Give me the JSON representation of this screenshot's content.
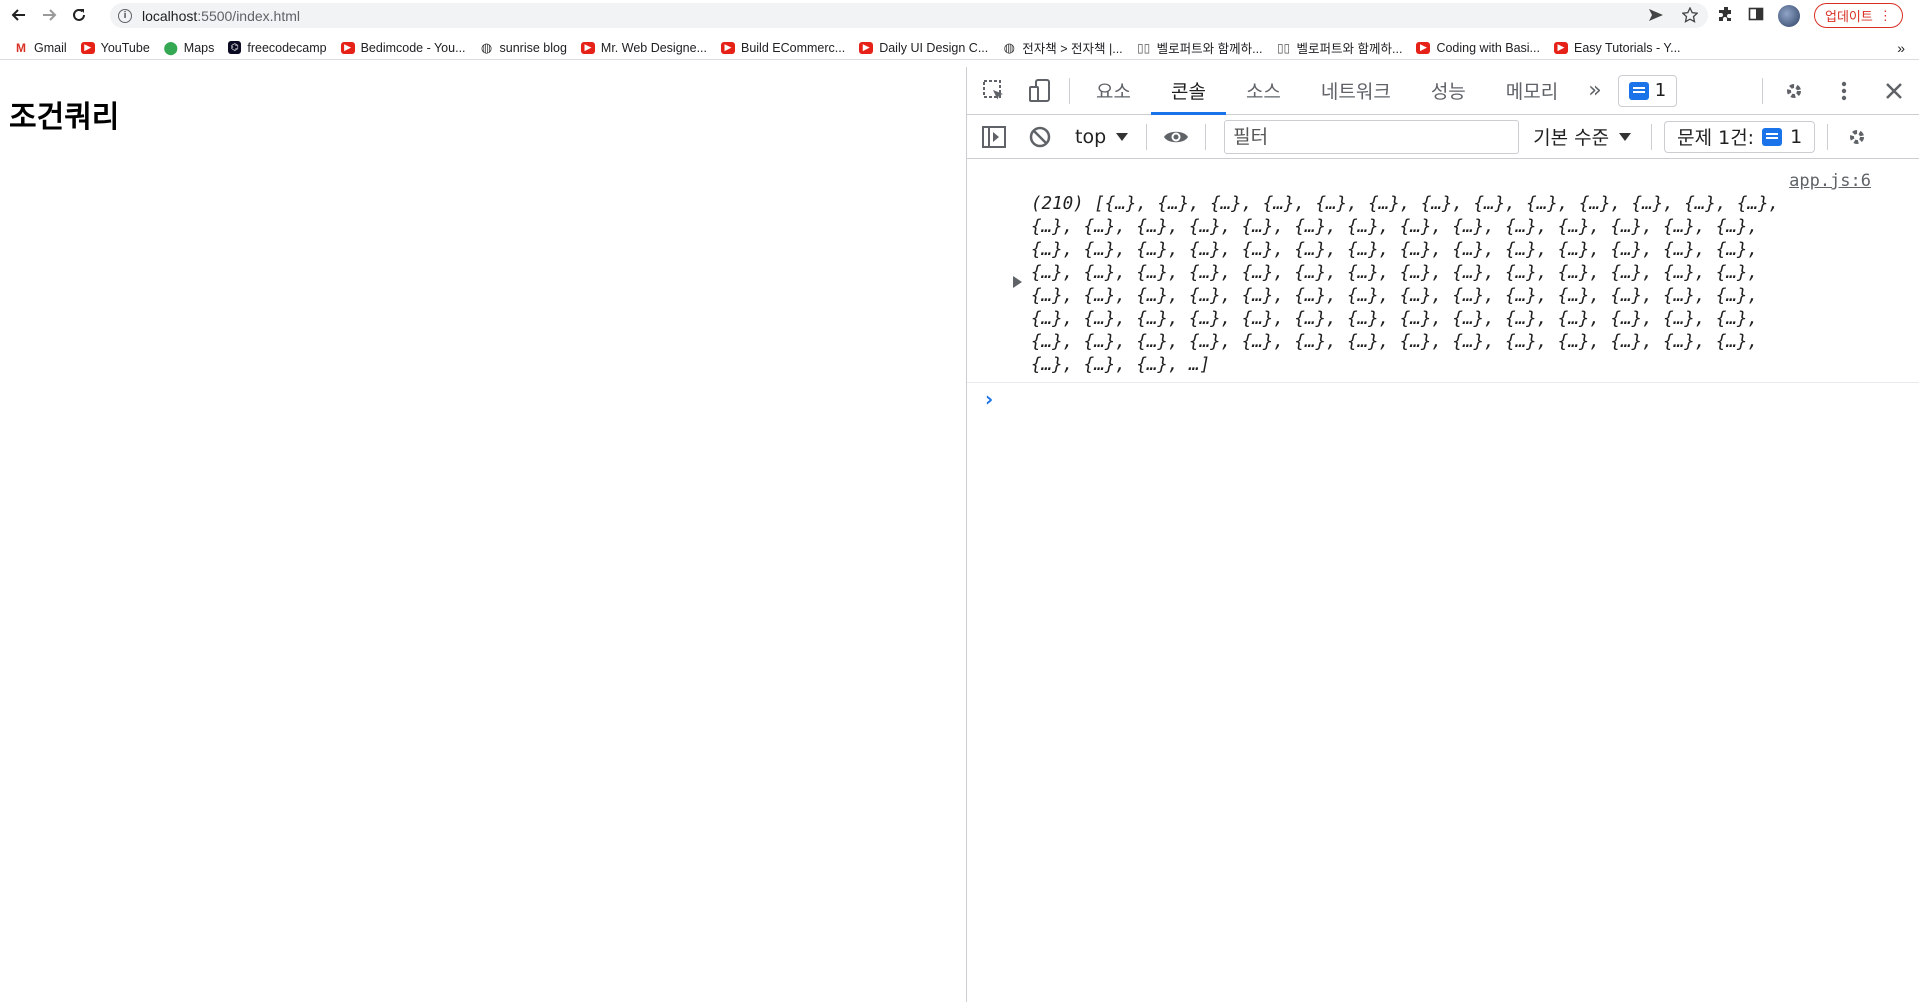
{
  "browser": {
    "url_host": "localhost",
    "url_path": ":5500/index.html",
    "update_label": "업데이트"
  },
  "bookmarks": [
    {
      "label": "Gmail",
      "icon": "gmail-icon"
    },
    {
      "label": "YouTube",
      "icon": "youtube-icon"
    },
    {
      "label": "Maps",
      "icon": "maps-icon"
    },
    {
      "label": "freecodecamp",
      "icon": "freecodecamp-icon"
    },
    {
      "label": "Bedimcode - You...",
      "icon": "youtube-icon"
    },
    {
      "label": "sunrise blog",
      "icon": "globe-icon"
    },
    {
      "label": "Mr. Web Designe...",
      "icon": "youtube-icon"
    },
    {
      "label": "Build ECommerc...",
      "icon": "youtube-icon"
    },
    {
      "label": "Daily UI Design C...",
      "icon": "youtube-icon"
    },
    {
      "label": "전자책 > 전자책 |...",
      "icon": "globe-icon"
    },
    {
      "label": "벨로퍼트와 함께하...",
      "icon": "book-icon"
    },
    {
      "label": "벨로퍼트와 함께하...",
      "icon": "book-icon"
    },
    {
      "label": "Coding with Basi...",
      "icon": "youtube-icon"
    },
    {
      "label": "Easy Tutorials - Y...",
      "icon": "youtube-icon"
    }
  ],
  "page": {
    "heading": "조건쿼리"
  },
  "devtools": {
    "tabs": [
      "요소",
      "콘솔",
      "소스",
      "네트워크",
      "성능",
      "메모리"
    ],
    "active_tab": "콘솔",
    "issues_count": "1",
    "context": "top",
    "filter_placeholder": "필터",
    "level": "기본 수준",
    "issue_label": "문제 1건:",
    "issue_count": "1",
    "console": {
      "source": "app.js:6",
      "lines": [
        "(210) [{…}, {…}, {…}, {…}, {…}, {…}, {…}, {…}, {…}, {…}, {…}, {…}, {…},",
        "{…}, {…}, {…}, {…}, {…}, {…}, {…}, {…}, {…}, {…}, {…}, {…}, {…}, {…},",
        "{…}, {…}, {…}, {…}, {…}, {…}, {…}, {…}, {…}, {…}, {…}, {…}, {…}, {…},",
        "{…}, {…}, {…}, {…}, {…}, {…}, {…}, {…}, {…}, {…}, {…}, {…}, {…}, {…},",
        "{…}, {…}, {…}, {…}, {…}, {…}, {…}, {…}, {…}, {…}, {…}, {…}, {…}, {…},",
        "{…}, {…}, {…}, {…}, {…}, {…}, {…}, {…}, {…}, {…}, {…}, {…}, {…}, {…},",
        "{…}, {…}, {…}, {…}, {…}, {…}, {…}, {…}, {…}, {…}, {…}, {…}, {…}, {…},",
        "{…}, {…}, {…}, …]"
      ]
    }
  }
}
